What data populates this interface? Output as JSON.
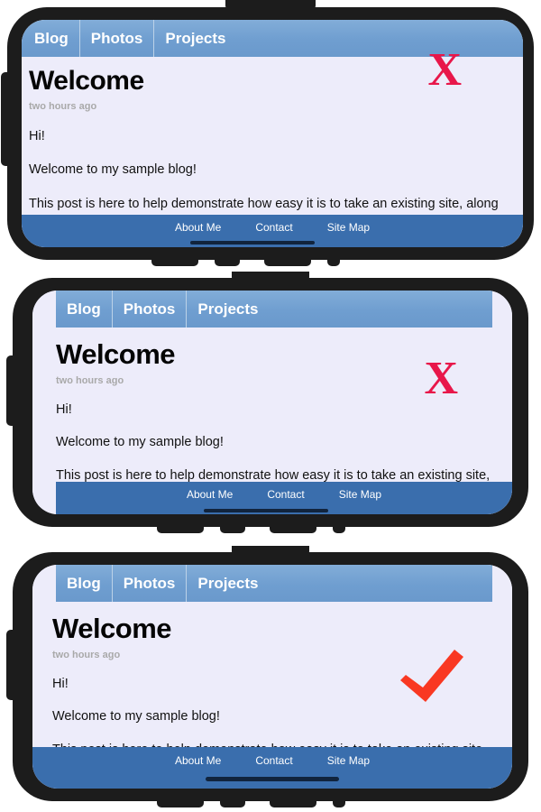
{
  "nav": {
    "items": [
      {
        "label": "Blog"
      },
      {
        "label": "Photos"
      },
      {
        "label": "Projects"
      }
    ]
  },
  "article": {
    "title": "Welcome",
    "timestamp": "two hours ago",
    "paragraphs": [
      "Hi!",
      "Welcome to my sample blog!",
      "This post is here to help demonstrate how easy it is to take an existing site, along with full-width bars and fixed-position elements, and make it take full advantage of iPhone X's edge-to-edge display."
    ]
  },
  "footer": {
    "links": [
      {
        "label": "About Me"
      },
      {
        "label": "Contact"
      },
      {
        "label": "Site Map"
      }
    ]
  },
  "panels": [
    {
      "id": "panel-1",
      "marker": {
        "type": "x-mark",
        "glyph": "X",
        "color": "#e8174a"
      }
    },
    {
      "id": "panel-2",
      "marker": {
        "type": "x-mark",
        "glyph": "X",
        "color": "#e8174a"
      }
    },
    {
      "id": "panel-3",
      "marker": {
        "type": "check-mark",
        "glyph": "✔",
        "color": "#f93822"
      }
    }
  ],
  "colors": {
    "navbar_blue": "#6f9ed0",
    "footer_blue": "#3a6ead",
    "screen_background": "#edecfa",
    "chassis": "#1c1c1c",
    "timestamp_gray": "#a9a9a9",
    "x_mark_red": "#e8174a",
    "check_mark_red": "#f93822"
  }
}
